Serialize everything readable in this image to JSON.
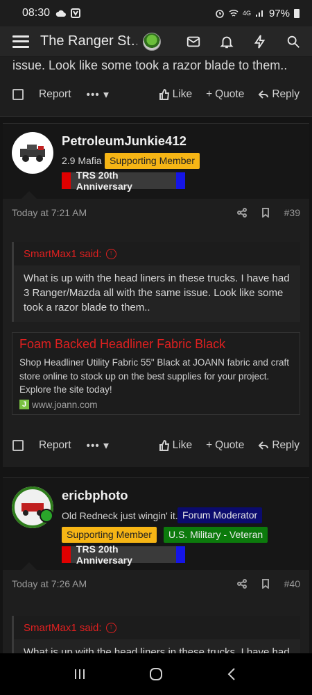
{
  "status_bar": {
    "time": "08:30",
    "network": "4G",
    "battery": "97%"
  },
  "app_bar": {
    "title": "The Ranger St…"
  },
  "prev_post": {
    "tail_text": "issue. Look like some took a razor blade to them..",
    "report": "Report",
    "more": "•••",
    "like": "Like",
    "quote": "Quote",
    "reply": "Reply"
  },
  "post39": {
    "username": "PetroleumJunkie412",
    "user_title": "2.9 Mafia",
    "badge_supporting": "Supporting Member",
    "trs_banner": "TRS 20th Anniversary",
    "timestamp": "Today at 7:21 AM",
    "post_number": "#39",
    "quote_author": "SmartMax1 said:",
    "quote_text": "What is up with the head liners in these trucks. I have had 3 Ranger/Mazda all with the same issue. Look like some took a razor blade to them..",
    "link_title": "Foam Backed Headliner Fabric Black",
    "link_desc": "Shop Headliner Utility Fabric 55\" Black at JOANN fabric and craft store online to stock up on the best supplies for your project. Explore the site today!",
    "link_site": "www.joann.com",
    "link_favicon": "J",
    "report": "Report",
    "more": "•••",
    "like": "Like",
    "quote": "Quote",
    "reply": "Reply"
  },
  "post40": {
    "username": "ericbphoto",
    "user_title": "Old Redneck just wingin' it.",
    "badge_moderator": "Forum Moderator",
    "badge_supporting": "Supporting Member",
    "badge_military": "U.S. Military - Veteran",
    "trs_banner": "TRS 20th Anniversary",
    "timestamp": "Today at 7:26 AM",
    "post_number": "#40",
    "quote_author": "SmartMax1 said:",
    "quote_text": "What is up with the head liners in these trucks. I have had"
  }
}
